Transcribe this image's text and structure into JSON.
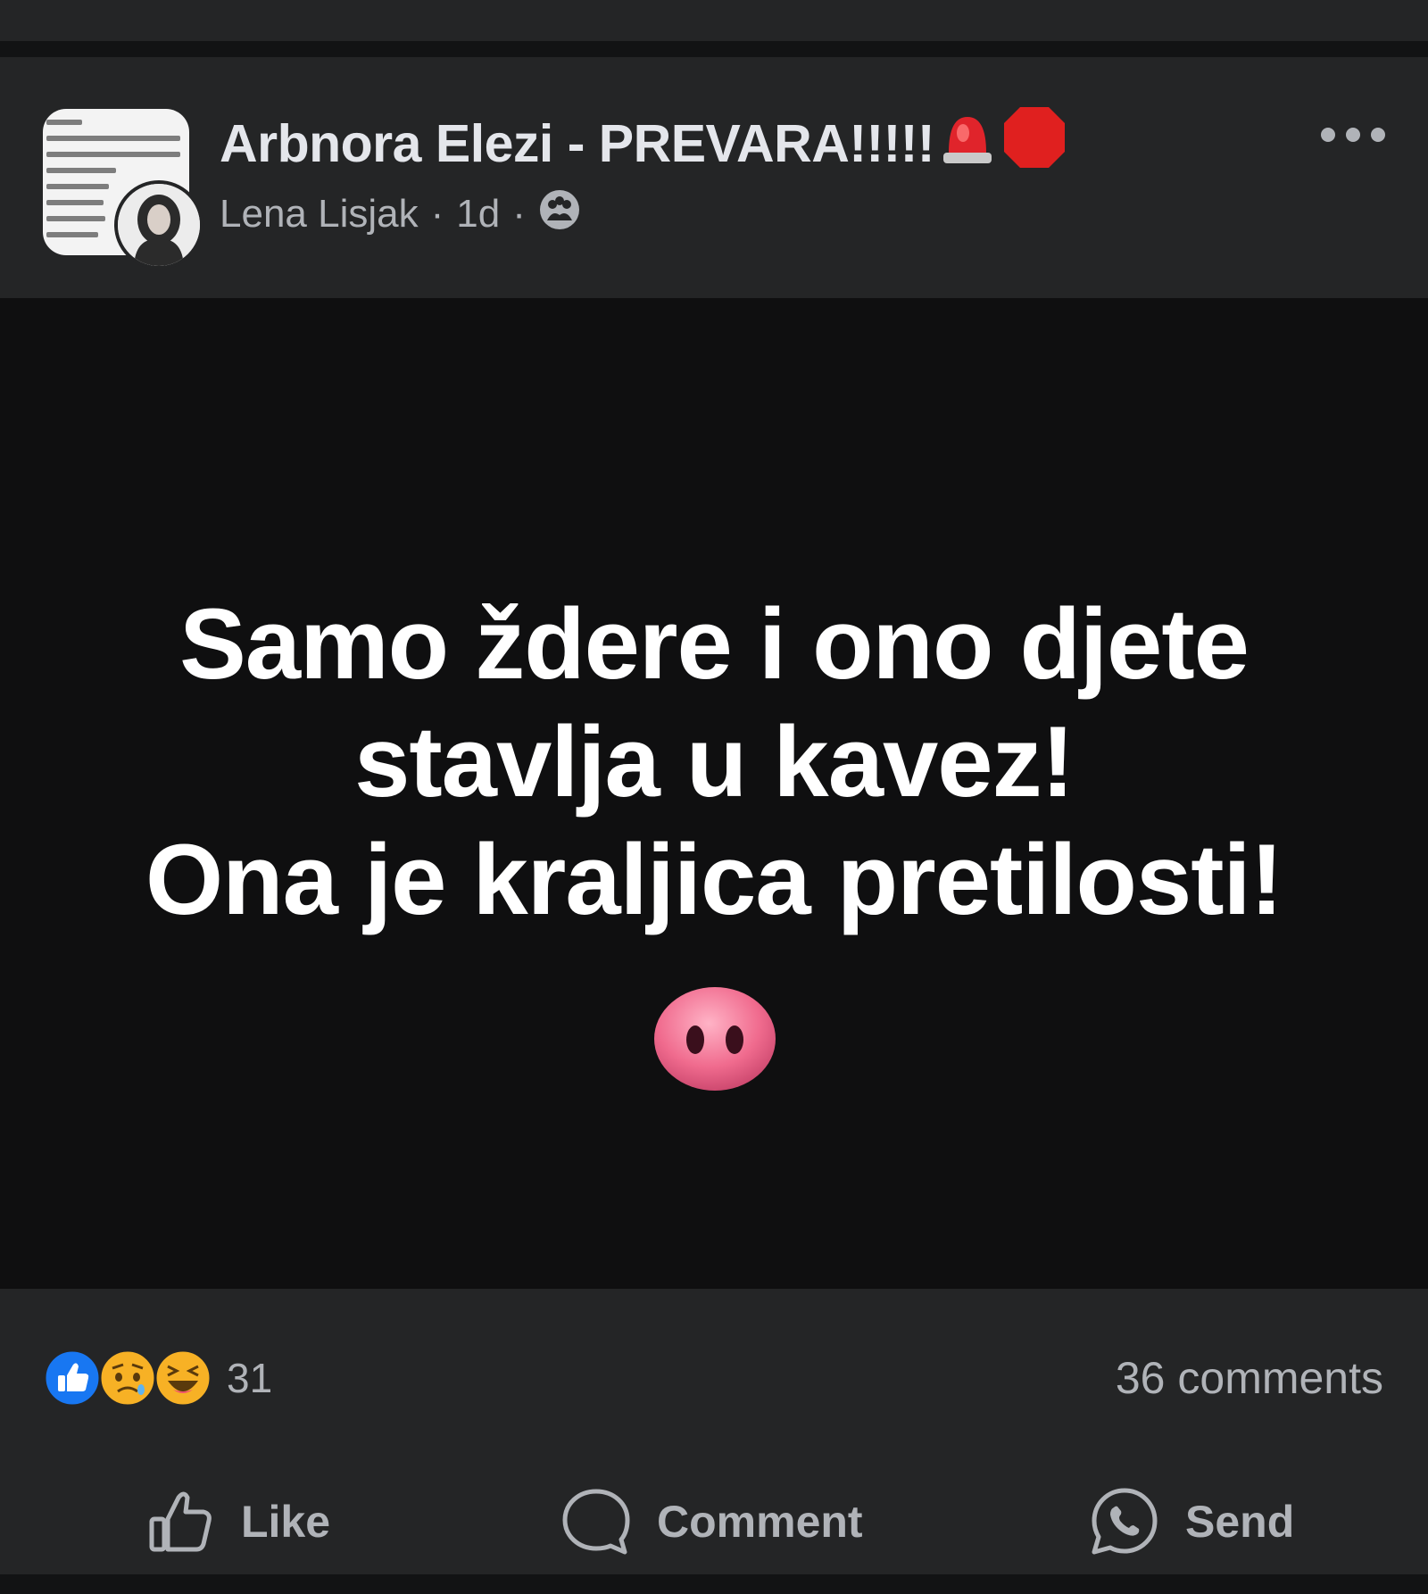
{
  "post": {
    "group_name": "Arbnora Elezi - PREVARA!!!!!",
    "author": "Lena Lisjak",
    "separator": "·",
    "time": "1d",
    "body_lines": [
      "Samo ždere i ono djete",
      "stavlja u kavez!",
      "Ona je kraljica pretilosti!"
    ],
    "body_emoji": "pig-nose-icon"
  },
  "stats": {
    "reactions": [
      "like-reaction-icon",
      "sad-reaction-icon",
      "haha-reaction-icon"
    ],
    "reaction_count": "31",
    "comments": "36 comments"
  },
  "actions": {
    "like_label": "Like",
    "comment_label": "Comment",
    "send_label": "Send"
  },
  "colors": {
    "background": "#18191a",
    "card": "#242526",
    "image_bg": "#0f0f10",
    "primary_text": "#e4e6eb",
    "secondary_text": "#b0b3b8",
    "like_blue": "#1877f2"
  }
}
